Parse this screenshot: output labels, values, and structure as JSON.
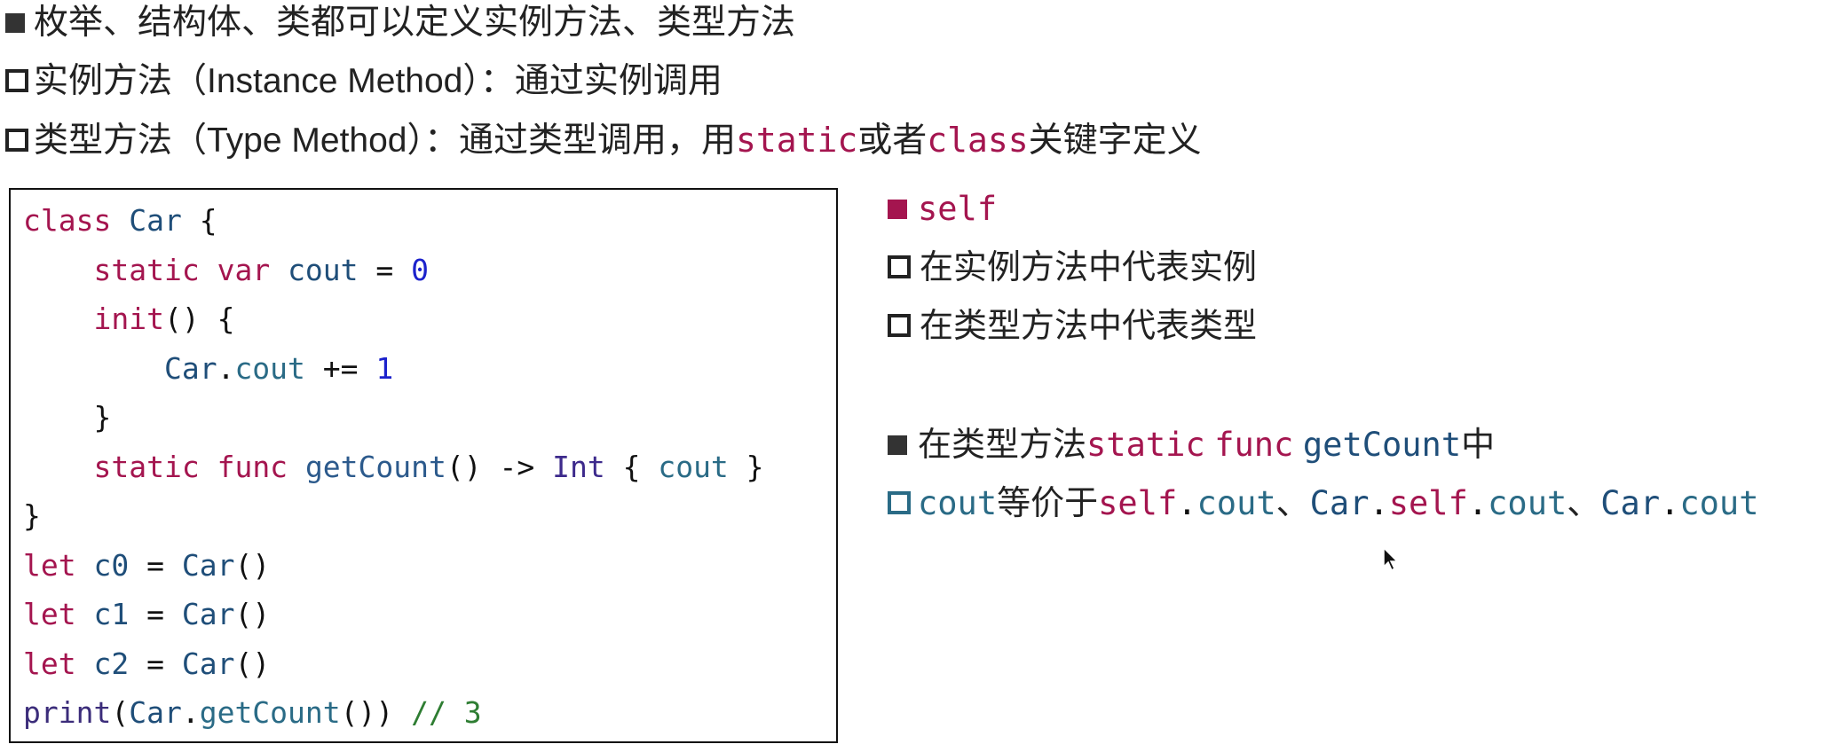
{
  "header": {
    "line1_text": "枚举、结构体、类都可以定义实例方法、类型方法",
    "line2_text": "实例方法（Instance Method）：通过实例调用",
    "line3_prefix": "类型方法（Type Method）：通过类型调用，用",
    "line3_kw_static": "static",
    "line3_mid": "或者",
    "line3_kw_class": "class",
    "line3_suffix": "关键字定义"
  },
  "code": {
    "l1": {
      "kw": "class",
      "name": "Car",
      "brace": " {"
    },
    "l2": {
      "indent": "    ",
      "kw1": "static",
      "kw2": "var",
      "name": "cout",
      "op": " = ",
      "num": "0"
    },
    "l3": {
      "indent": "    ",
      "kw": "init",
      "rest": "() {"
    },
    "l4": {
      "indent": "        ",
      "type": "Car",
      "dot": ".",
      "member": "cout",
      "op": " += ",
      "num": "1"
    },
    "l5": {
      "indent": "    ",
      "brace": "}"
    },
    "l6": {
      "indent": "    ",
      "kw1": "static",
      "kw2": "func",
      "fname": "getCount",
      "parens": "() -> ",
      "rtype": "Int",
      "b1": " { ",
      "member": "cout",
      "b2": " }"
    },
    "l7": {
      "brace": "}"
    },
    "l8": {
      "kw": "let",
      "name": "c0",
      "op": " = ",
      "type": "Car",
      "call": "()"
    },
    "l9": {
      "kw": "let",
      "name": "c1",
      "op": " = ",
      "type": "Car",
      "call": "()"
    },
    "l10": {
      "kw": "let",
      "name": "c2",
      "op": " = ",
      "type": "Car",
      "call": "()"
    },
    "l11": {
      "fn": "print",
      "p1": "(",
      "type": "Car",
      "dot": ".",
      "member": "getCount",
      "p2": "()) ",
      "comment": "// 3"
    }
  },
  "right": {
    "self_title": "self",
    "self_item1": "在实例方法中代表实例",
    "self_item2": "在类型方法中代表类型",
    "gc_prefix": "在类型方法",
    "gc_kw_static": "static",
    "gc_kw_func": "func",
    "gc_name": "getCount",
    "gc_suffix": "中",
    "eq_cout": "cout",
    "eq_text1": "等价于",
    "eq_self1": "self",
    "eq_dot1": ".",
    "eq_cout2": "cout",
    "eq_sep1": "、",
    "eq_car1": "Car",
    "eq_dot2": ".",
    "eq_self2": "self",
    "eq_dot3": ".",
    "eq_cout3": "cout",
    "eq_sep2": "、",
    "eq_car2": "Car",
    "eq_dot4": ".",
    "eq_cout4": "cout"
  },
  "icons": {
    "cursor": "mouse-pointer-icon"
  },
  "colors": {
    "keyword": "#a4154f",
    "type": "#1f4e79",
    "number": "#1c22cc",
    "comment": "#2e7d32",
    "member": "#2a6b86"
  }
}
